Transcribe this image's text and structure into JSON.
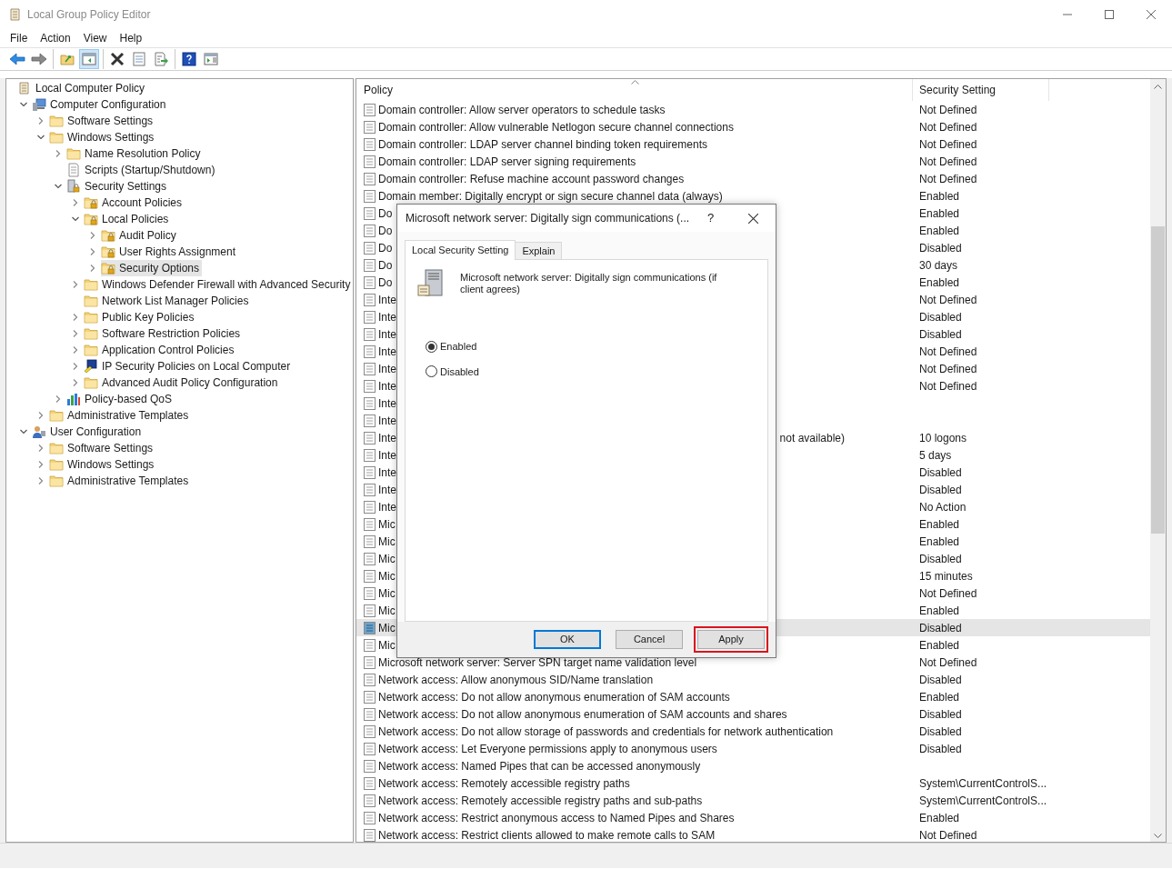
{
  "window": {
    "title": "Local Group Policy Editor"
  },
  "menu": [
    "File",
    "Action",
    "View",
    "Help"
  ],
  "toolbar_groups": [
    {
      "buttons": [
        {
          "kind": "back",
          "pressed": false
        },
        {
          "kind": "forward",
          "pressed": false
        }
      ]
    },
    {
      "buttons": [
        {
          "kind": "up",
          "pressed": false
        },
        {
          "kind": "tree",
          "pressed": true
        }
      ]
    },
    {
      "buttons": [
        {
          "kind": "delete",
          "pressed": false
        },
        {
          "kind": "properties",
          "pressed": false
        },
        {
          "kind": "export",
          "pressed": false
        }
      ]
    },
    {
      "buttons": [
        {
          "kind": "help",
          "pressed": false
        },
        {
          "kind": "pane",
          "pressed": false
        }
      ]
    }
  ],
  "tree": [
    {
      "label": "Local Computer Policy",
      "kind": "policy",
      "selected": false,
      "children": [
        {
          "label": "Computer Configuration",
          "kind": "computer",
          "expanded": true,
          "selected": false,
          "children": [
            {
              "label": "Software Settings",
              "kind": "folder",
              "expanded": false,
              "selected": false
            },
            {
              "label": "Windows Settings",
              "kind": "folder",
              "expanded": true,
              "selected": false,
              "children": [
                {
                  "label": "Name Resolution Policy",
                  "kind": "folder",
                  "expanded": false,
                  "selected": false
                },
                {
                  "label": "Scripts (Startup/Shutdown)",
                  "kind": "script",
                  "selected": false
                },
                {
                  "label": "Security Settings",
                  "kind": "security",
                  "expanded": true,
                  "selected": false,
                  "children": [
                    {
                      "label": "Account Policies",
                      "kind": "lockfolder",
                      "expanded": false,
                      "selected": false
                    },
                    {
                      "label": "Local Policies",
                      "kind": "lockfolder",
                      "expanded": true,
                      "selected": false,
                      "children": [
                        {
                          "label": "Audit Policy",
                          "kind": "lockfolder",
                          "expanded": false,
                          "selected": false
                        },
                        {
                          "label": "User Rights Assignment",
                          "kind": "lockfolder",
                          "expanded": false,
                          "selected": false
                        },
                        {
                          "label": "Security Options",
                          "kind": "lockfolder",
                          "expanded": false,
                          "selected": true
                        }
                      ]
                    },
                    {
                      "label": "Windows Defender Firewall with Advanced Security",
                      "kind": "folder",
                      "expanded": false,
                      "selected": false
                    },
                    {
                      "label": "Network List Manager Policies",
                      "kind": "folder",
                      "selected": false
                    },
                    {
                      "label": "Public Key Policies",
                      "kind": "folder",
                      "expanded": false,
                      "selected": false
                    },
                    {
                      "label": "Software Restriction Policies",
                      "kind": "folder",
                      "expanded": false,
                      "selected": false
                    },
                    {
                      "label": "Application Control Policies",
                      "kind": "folder",
                      "expanded": false,
                      "selected": false
                    },
                    {
                      "label": "IP Security Policies on Local Computer",
                      "kind": "ipsec",
                      "expanded": false,
                      "selected": false
                    },
                    {
                      "label": "Advanced Audit Policy Configuration",
                      "kind": "folder",
                      "expanded": false,
                      "selected": false
                    }
                  ]
                },
                {
                  "label": "Policy-based QoS",
                  "kind": "qos",
                  "expanded": false,
                  "selected": false
                }
              ]
            },
            {
              "label": "Administrative Templates",
              "kind": "folder",
              "expanded": false,
              "selected": false
            }
          ]
        },
        {
          "label": "User Configuration",
          "kind": "user",
          "expanded": true,
          "selected": false,
          "children": [
            {
              "label": "Software Settings",
              "kind": "folder",
              "expanded": false,
              "selected": false
            },
            {
              "label": "Windows Settings",
              "kind": "folder",
              "expanded": false,
              "selected": false
            },
            {
              "label": "Administrative Templates",
              "kind": "folder",
              "expanded": false,
              "selected": false
            }
          ]
        }
      ]
    }
  ],
  "table": {
    "columns": [
      "Policy",
      "Security Setting"
    ],
    "rows": [
      {
        "policy": "Domain controller: Allow server operators to schedule tasks",
        "setting": "Not Defined",
        "selected": false
      },
      {
        "policy": "Domain controller: Allow vulnerable Netlogon secure channel connections",
        "setting": "Not Defined",
        "selected": false
      },
      {
        "policy": "Domain controller: LDAP server channel binding token requirements",
        "setting": "Not Defined",
        "selected": false
      },
      {
        "policy": "Domain controller: LDAP server signing requirements",
        "setting": "Not Defined",
        "selected": false
      },
      {
        "policy": "Domain controller: Refuse machine account password changes",
        "setting": "Not Defined",
        "selected": false
      },
      {
        "policy": "Domain member: Digitally encrypt or sign secure channel data (always)",
        "setting": "Enabled",
        "selected": false
      },
      {
        "policy": "Do",
        "setting": "Enabled",
        "selected": false
      },
      {
        "policy": "Do",
        "setting": "Enabled",
        "selected": false
      },
      {
        "policy": "Do",
        "setting": "Disabled",
        "selected": false
      },
      {
        "policy": "Do",
        "setting": "30 days",
        "selected": false
      },
      {
        "policy": "Do",
        "setting": "Enabled",
        "selected": false
      },
      {
        "policy": "Inte",
        "setting": "Not Defined",
        "selected": false
      },
      {
        "policy": "Inte",
        "setting": "Disabled",
        "selected": false
      },
      {
        "policy": "Inte",
        "setting": "Disabled",
        "selected": false
      },
      {
        "policy": "Inte",
        "setting": "Not Defined",
        "selected": false
      },
      {
        "policy": "Inte",
        "setting": "Not Defined",
        "selected": false
      },
      {
        "policy": "Inte",
        "setting": "Not Defined",
        "selected": false
      },
      {
        "policy": "Inte",
        "selected": false
      },
      {
        "policy": "Inte",
        "selected": false
      },
      {
        "policy": "Inte",
        "policy_tail": "not available)",
        "setting": "10 logons",
        "selected": false
      },
      {
        "policy": "Inte",
        "setting": "5 days",
        "selected": false
      },
      {
        "policy": "Inte",
        "setting": "Disabled",
        "selected": false
      },
      {
        "policy": "Inte",
        "setting": "Disabled",
        "selected": false
      },
      {
        "policy": "Inte",
        "setting": "No Action",
        "selected": false
      },
      {
        "policy": "Mic",
        "setting": "Enabled",
        "selected": false
      },
      {
        "policy": "Mic",
        "setting": "Enabled",
        "selected": false
      },
      {
        "policy": "Mic",
        "setting": "Disabled",
        "selected": false
      },
      {
        "policy": "Mic",
        "setting": "15 minutes",
        "selected": false
      },
      {
        "policy": "Mic",
        "setting": "Not Defined",
        "selected": false
      },
      {
        "policy": "Mic",
        "setting": "Enabled",
        "selected": false
      },
      {
        "policy": "Mic",
        "setting": "Disabled",
        "selected": true
      },
      {
        "policy": "Mic",
        "setting": "Enabled",
        "selected": false
      },
      {
        "policy": "Microsoft network server: Server SPN target name validation level",
        "setting": "Not Defined",
        "selected": false
      },
      {
        "policy": "Network access: Allow anonymous SID/Name translation",
        "setting": "Disabled",
        "selected": false
      },
      {
        "policy": "Network access: Do not allow anonymous enumeration of SAM accounts",
        "setting": "Enabled",
        "selected": false
      },
      {
        "policy": "Network access: Do not allow anonymous enumeration of SAM accounts and shares",
        "setting": "Disabled",
        "selected": false
      },
      {
        "policy": "Network access: Do not allow storage of passwords and credentials for network authentication",
        "setting": "Disabled",
        "selected": false
      },
      {
        "policy": "Network access: Let Everyone permissions apply to anonymous users",
        "setting": "Disabled",
        "selected": false
      },
      {
        "policy": "Network access: Named Pipes that can be accessed anonymously",
        "selected": false
      },
      {
        "policy": "Network access: Remotely accessible registry paths",
        "setting": "System\\CurrentControlS...",
        "selected": false
      },
      {
        "policy": "Network access: Remotely accessible registry paths and sub-paths",
        "setting": "System\\CurrentControlS...",
        "selected": false
      },
      {
        "policy": "Network access: Restrict anonymous access to Named Pipes and Shares",
        "setting": "Enabled",
        "selected": false
      },
      {
        "policy": "Network access: Restrict clients allowed to make remote calls to SAM",
        "setting": "Not Defined",
        "selected": false
      }
    ]
  },
  "dialog": {
    "title": "Microsoft network server: Digitally sign communications (...",
    "help": "?",
    "tabs": [
      {
        "label": "Local Security Setting",
        "selected": true
      },
      {
        "label": "Explain",
        "selected": false
      }
    ],
    "description": "Microsoft network server: Digitally sign communications (if client agrees)",
    "options": [
      {
        "label": "Enabled",
        "selected": true
      },
      {
        "label": "Disabled",
        "selected": false
      }
    ],
    "buttons": [
      {
        "label": "OK",
        "default": true,
        "highlighted": false
      },
      {
        "label": "Cancel",
        "default": false,
        "highlighted": false
      },
      {
        "label": "Apply",
        "default": false,
        "highlighted": true
      }
    ]
  }
}
